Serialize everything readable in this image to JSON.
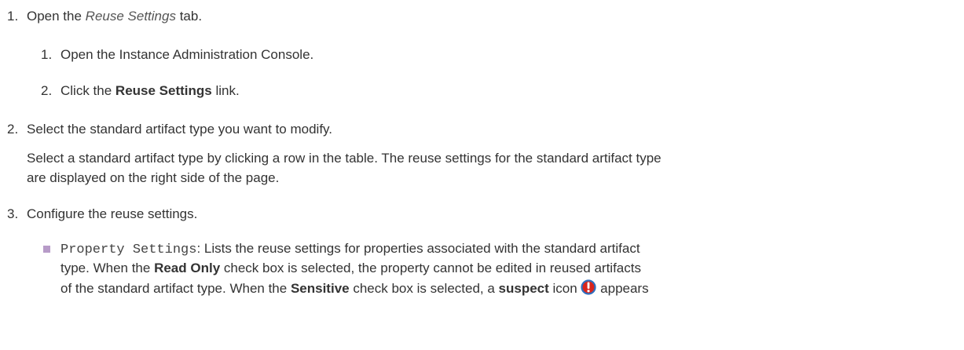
{
  "step1": {
    "num": "1.",
    "prefix": "Open the ",
    "tab_name": "Reuse Settings",
    "suffix": " tab.",
    "sub": [
      {
        "num": "1.",
        "text": "Open the Instance Administration Console."
      },
      {
        "num": "2.",
        "prefix": "Click the ",
        "bold": "Reuse Settings",
        "suffix": " link."
      }
    ]
  },
  "step2": {
    "num": "2.",
    "text": "Select the standard artifact type you want to modify.",
    "para_line1": "Select a standard artifact type by clicking a row in the table. The reuse settings for the standard artifact type",
    "para_line2": "are displayed on the right side of the page."
  },
  "step3": {
    "num": "3.",
    "text": "Configure the reuse settings.",
    "bullet": {
      "code": "Property Settings",
      "line1_rest": ": Lists the reuse settings for properties associated with the standard artifact",
      "line2_a": "type. When the ",
      "line2_b": "Read Only",
      "line2_c": " check box is selected, the property cannot be edited in reused artifacts",
      "line3_a": "of the standard artifact type. When the ",
      "line3_b": "Sensitive",
      "line3_c": " check box is selected, a ",
      "line3_d": "suspect",
      "line3_e": " icon ",
      "line3_f": " appears"
    }
  },
  "colors": {
    "bullet": "#b79bc8",
    "icon_red": "#d9251d",
    "icon_blue": "#2f6fbf"
  },
  "icons": [
    "suspect-icon"
  ]
}
